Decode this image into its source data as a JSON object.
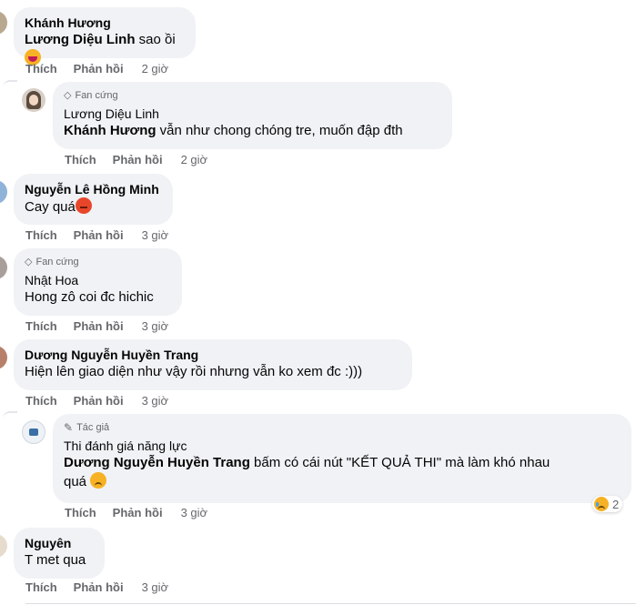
{
  "comments": [
    {
      "author": "Khánh Hương",
      "mention": "Lương Diệu Linh",
      "text": " sao ồi",
      "like": "Thích",
      "reply": "Phản hồi",
      "time": "2 giờ"
    },
    {
      "badge": "Fan cứng",
      "author": "Lương Diệu Linh",
      "mention": "Khánh Hương",
      "text": " vẫn như chong chóng tre, muốn đập đth",
      "like": "Thích",
      "reply": "Phản hồi",
      "time": "2 giờ"
    },
    {
      "author": "Nguyễn Lê Hồng Minh",
      "text": "Cay quá",
      "like": "Thích",
      "reply": "Phản hồi",
      "time": "3 giờ"
    },
    {
      "badge": "Fan cứng",
      "author": "Nhật Hoa",
      "text": "Hong zô coi đc hichic",
      "like": "Thích",
      "reply": "Phản hồi",
      "time": "3 giờ"
    },
    {
      "author": "Dương Nguyễn Huyền Trang",
      "text": "Hiện lên giao diện như vậy rồi nhưng vẫn ko xem đc :)))",
      "like": "Thích",
      "reply": "Phản hồi",
      "time": "3 giờ"
    },
    {
      "badge": "Tác giả",
      "author": "Thi đánh giá năng lực",
      "mention": "Dương Nguyễn Huyền Trang",
      "text1": " bấm có cái nút \"KẾT QUẢ THI\" mà làm khó nhau",
      "text2": "quá",
      "like": "Thích",
      "reply": "Phản hồi",
      "time": "3 giờ",
      "reaction_count": "2"
    },
    {
      "author": "Nguyên",
      "text": "T met qua",
      "like": "Thích",
      "reply": "Phản hồi",
      "time": "3 giờ"
    }
  ],
  "colors": {
    "bubble": "#f0f2f5",
    "muted": "#65676b",
    "text": "#050505"
  }
}
